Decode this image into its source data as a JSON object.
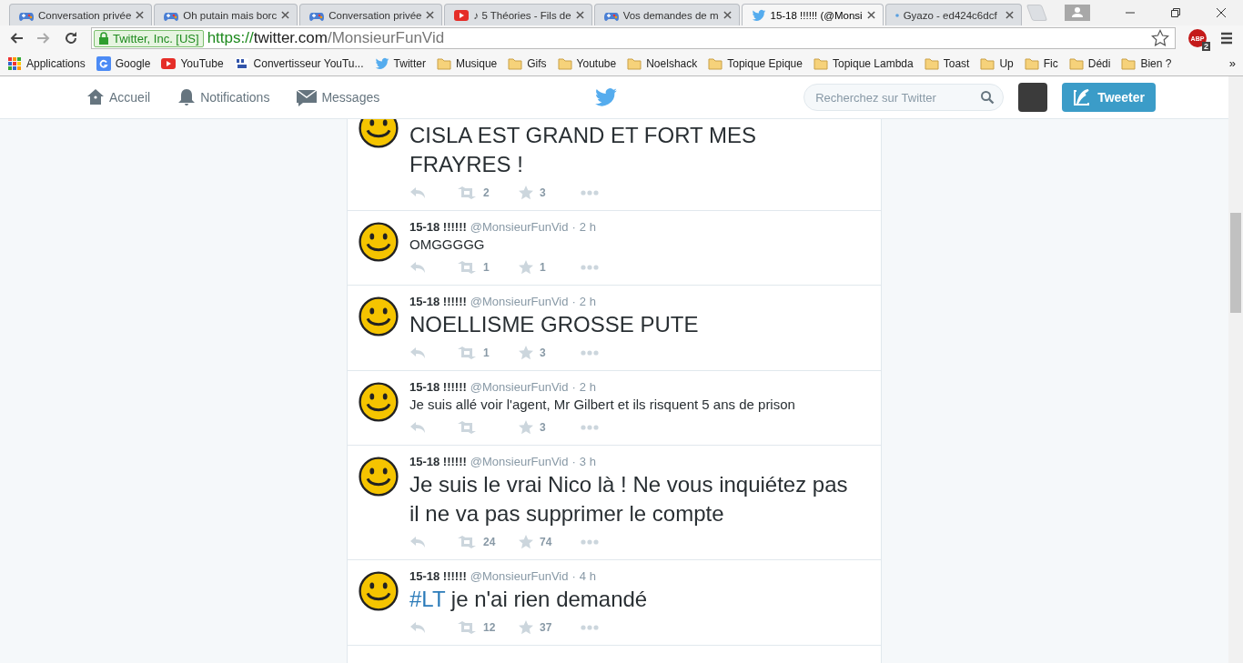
{
  "browser": {
    "tabs": [
      {
        "title": "Conversation privée",
        "kind": "gamepad",
        "selected": false
      },
      {
        "title": "Oh putain mais borc",
        "kind": "gamepad",
        "selected": false
      },
      {
        "title": "Conversation privée",
        "kind": "gamepad",
        "selected": false
      },
      {
        "title": "♪ 5 Théories - Fils de",
        "kind": "youtube",
        "selected": false
      },
      {
        "title": "Vos demandes de m",
        "kind": "gamepad",
        "selected": false
      },
      {
        "title": "15-18 !!!!!! (@Monsi",
        "kind": "twitter",
        "selected": true
      },
      {
        "title": "Gyazo - ed424c6dcf",
        "kind": "dot",
        "selected": false
      }
    ],
    "security_badge": "Twitter, Inc. [US]",
    "url": {
      "scheme": "https://",
      "host": "twitter.com",
      "path": "/MonsieurFunVid"
    },
    "adblock": {
      "label": "ABP",
      "count": "2"
    },
    "bookmarks": [
      {
        "label": "Applications",
        "kind": "apps"
      },
      {
        "label": "Google",
        "kind": "google"
      },
      {
        "label": "YouTube",
        "kind": "youtube"
      },
      {
        "label": "Convertisseur YouTu...",
        "kind": "ytmp3"
      },
      {
        "label": "Twitter",
        "kind": "twitter"
      },
      {
        "label": "Musique",
        "kind": "folder"
      },
      {
        "label": "Gifs",
        "kind": "folder"
      },
      {
        "label": "Youtube",
        "kind": "folder"
      },
      {
        "label": "Noelshack",
        "kind": "folder"
      },
      {
        "label": "Topique Epique",
        "kind": "folder"
      },
      {
        "label": "Topique Lambda",
        "kind": "folder"
      },
      {
        "label": "Toast",
        "kind": "folder"
      },
      {
        "label": "Up",
        "kind": "folder"
      },
      {
        "label": "Fic",
        "kind": "folder"
      },
      {
        "label": "Dédi",
        "kind": "folder"
      },
      {
        "label": "Bien ?",
        "kind": "folder"
      }
    ],
    "bookmarks_overflow": "»"
  },
  "nav": {
    "items": [
      {
        "label": "Accueil",
        "kind": "home"
      },
      {
        "label": "Notifications",
        "kind": "bell"
      },
      {
        "label": "Messages",
        "kind": "mail"
      }
    ],
    "search": {
      "placeholder": "Recherchez sur Twitter"
    },
    "tweet_button": "Tweeter"
  },
  "tweets": [
    {
      "text": "CISLA EST GRAND ET FORT MES FRAYRES !",
      "kind": "large",
      "retweets": "2",
      "favorites": "3"
    },
    {
      "name": "15-18 !!!!!!",
      "handle": "@MonsieurFunVid",
      "separator": "·",
      "time": "2 h",
      "text": "OMGGGGG",
      "kind": "small",
      "retweets": "1",
      "favorites": "1"
    },
    {
      "name": "15-18 !!!!!!",
      "handle": "@MonsieurFunVid",
      "separator": "·",
      "time": "2 h",
      "text": "NOELLISME GROSSE PUTE",
      "kind": "large",
      "retweets": "1",
      "favorites": "3"
    },
    {
      "name": "15-18 !!!!!!",
      "handle": "@MonsieurFunVid",
      "separator": "·",
      "time": "2 h",
      "text": "Je suis allé voir l'agent, Mr Gilbert et ils risquent 5 ans de prison",
      "kind": "small",
      "favorites": "3"
    },
    {
      "name": "15-18 !!!!!!",
      "handle": "@MonsieurFunVid",
      "separator": "·",
      "time": "3 h",
      "text": "Je suis le vrai Nico là ! Ne vous inquiétez pas il ne va pas supprimer le compte",
      "kind": "large",
      "retweets": "24",
      "favorites": "74"
    },
    {
      "name": "15-18 !!!!!!",
      "handle": "@MonsieurFunVid",
      "separator": "·",
      "time": "4 h",
      "hashtag": "#LT",
      "text": "je n'ai rien demandé",
      "kind": "large",
      "retweets": "12",
      "favorites": "37"
    }
  ]
}
